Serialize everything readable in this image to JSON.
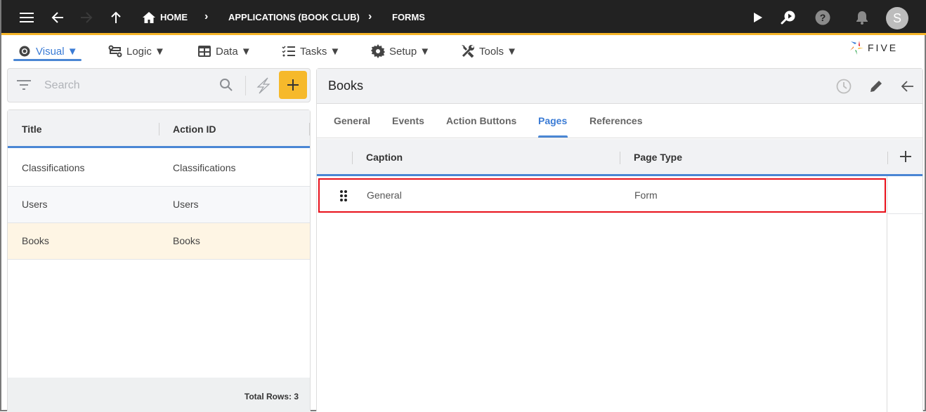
{
  "topbar": {
    "breadcrumbs": [
      "HOME",
      "APPLICATIONS (BOOK CLUB)",
      "FORMS"
    ],
    "avatar_initial": "S",
    "icons": [
      "menu-icon",
      "back-arrow-icon",
      "forward-arrow-icon",
      "up-arrow-icon",
      "home-icon",
      "play-icon",
      "search-play-icon",
      "help-icon",
      "bell-icon"
    ]
  },
  "menubar": {
    "items": [
      {
        "label": "Visual ▼",
        "icon": "eye-icon",
        "active": true
      },
      {
        "label": "Logic ▼",
        "icon": "flow-icon"
      },
      {
        "label": "Data ▼",
        "icon": "table-icon"
      },
      {
        "label": "Tasks ▼",
        "icon": "checklist-icon"
      },
      {
        "label": "Setup ▼",
        "icon": "gear-icon"
      },
      {
        "label": "Tools ▼",
        "icon": "tools-icon"
      }
    ],
    "logo_text": "FIVE"
  },
  "left": {
    "search_placeholder": "Search",
    "columns": [
      "Title",
      "Action ID"
    ],
    "rows": [
      {
        "title": "Classifications",
        "action_id": "Classifications"
      },
      {
        "title": "Users",
        "action_id": "Users"
      },
      {
        "title": "Books",
        "action_id": "Books"
      }
    ],
    "total_rows": "Total Rows: 3"
  },
  "detail": {
    "title": "Books",
    "tabs": [
      "General",
      "Events",
      "Action Buttons",
      "Pages",
      "References"
    ],
    "active_tab": "Pages",
    "columns": [
      "Caption",
      "Page Type"
    ],
    "rows": [
      {
        "caption": "General",
        "page_type": "Form"
      }
    ]
  },
  "colors": {
    "accent": "#4a86d4",
    "brand_yellow": "#f6b92b",
    "selected_row": "#fef5e4",
    "highlight_border": "#e8101a",
    "topbar": "#222222"
  }
}
